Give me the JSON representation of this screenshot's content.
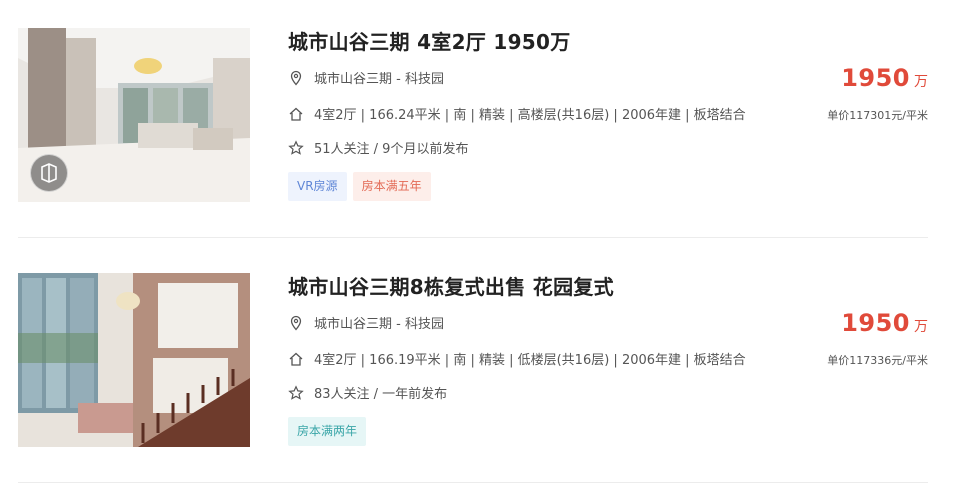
{
  "listings": [
    {
      "title": "城市山谷三期 4室2厅 1950万",
      "address": "城市山谷三期 - 科技园",
      "info": "4室2厅 | 166.24平米 | 南 | 精装 | 高楼层(共16层) | 2006年建 | 板塔结合",
      "follow": "51人关注 / 9个月以前发布",
      "tags": [
        "VR房源",
        "房本满五年"
      ],
      "price": "1950",
      "price_unit": "万",
      "unit_price": "单价117301元/平米"
    },
    {
      "title": "城市山谷三期8栋复式出售 花园复式",
      "address": "城市山谷三期 - 科技园",
      "info": "4室2厅 | 166.19平米 | 南 | 精装 | 低楼层(共16层) | 2006年建 | 板塔结合",
      "follow": "83人关注 / 一年前发布",
      "tags": [
        "房本满两年"
      ],
      "price": "1950",
      "price_unit": "万",
      "unit_price": "单价117336元/平米"
    }
  ],
  "icons": {
    "address": "location-pin-icon",
    "info": "house-icon",
    "follow": "star-icon",
    "vr": "vr-icon"
  },
  "colors": {
    "price": "#e04a3a",
    "tag_vr": "#5f86d6",
    "tag_red": "#e36a55",
    "tag_teal": "#3aa6a8"
  }
}
